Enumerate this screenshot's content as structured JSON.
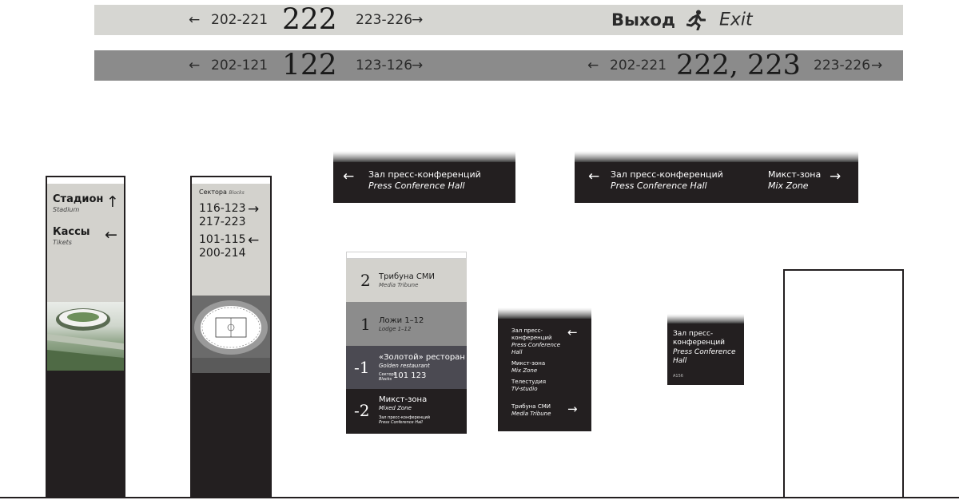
{
  "banner_top": {
    "left_arrow": "←",
    "left_range": "202-221",
    "number": "222",
    "right_range": "223-226",
    "right_arrow": "→",
    "exit_ru": "Выход",
    "exit_en": "Exit"
  },
  "banner_bottom": {
    "left_arrow": "←",
    "left_range": "202-121",
    "number": "122",
    "right_range": "123-126",
    "right_arrow": "→",
    "left2_arrow": "←",
    "left2_range": "202-221",
    "number2": "222, 223",
    "right2_range": "223-226",
    "right2_arrow": "→"
  },
  "pylon1": {
    "item1_ru": "Стадион",
    "item1_en": "Stadium",
    "item1_arrow": "↑",
    "item2_ru": "Кассы",
    "item2_en": "Tikets",
    "item2_arrow": "←"
  },
  "pylon2": {
    "header_ru": "Сектора",
    "header_en": "Blocks",
    "row1_a": "116-123",
    "row1_b": "217-223",
    "row1_arrow": "→",
    "row2_a": "101-115",
    "row2_b": "200-214",
    "row2_arrow": "←"
  },
  "hang1": {
    "arrow": "←",
    "ru": "Зал пресс-конференций",
    "en": "Press Conference Hall"
  },
  "hang2": {
    "left_arrow": "←",
    "left_ru": "Зал пресс-конференций",
    "left_en": "Press Conference Hall",
    "right_ru": "Микст-зона",
    "right_en": "Mix Zone",
    "right_arrow": "→"
  },
  "directory": {
    "floor2_num": "2",
    "floor2_ru": "Трибуна СМИ",
    "floor2_en": "Media Tribune",
    "floor1_num": "1",
    "floor1_ru": "Ложи 1–12",
    "floor1_en": "Lodge 1–12",
    "floorm1_num": "-1",
    "floorm1_ru": "«Золотой» ресторан",
    "floorm1_en": "Golden restaurant",
    "floorm1_sectors_ru": "Сектора",
    "floorm1_sectors_en": "Blocks",
    "floorm1_sectors": "101 123",
    "floorm2_num": "-2",
    "floorm2_ru": "Микст-зона",
    "floorm2_en": "Mixed Zone",
    "floorm2_sub_ru": "Зал пресс-конференций",
    "floorm2_sub_en": "Press Conference Hall"
  },
  "wall_sign": {
    "i1_ru": "Зал пресс-\nконференций",
    "i1_en": "Press Conference\nHall",
    "i1_arrow": "←",
    "i2_ru": "Микст-зона",
    "i2_en": "Mix Zone",
    "i3_ru": "Телестудия",
    "i3_en": "TV-studio",
    "i4_ru": "Трибуна СМИ",
    "i4_en": "Media Tribune",
    "i4_arrow": "→"
  },
  "door_sign": {
    "ru": "Зал пресс-\nконференций",
    "en": "Press Conference\nHall",
    "code": "A156"
  },
  "colors": {
    "dark": "#231f20",
    "light_panel": "#d3d2cd",
    "band_light": "#d6d6d2",
    "band_dark": "#8b8b8b"
  }
}
